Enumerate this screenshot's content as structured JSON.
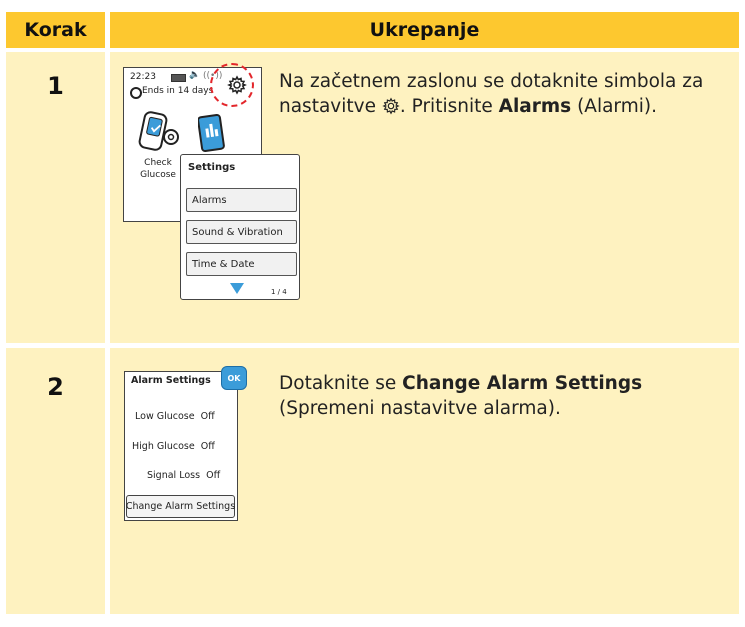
{
  "header": {
    "step_label": "Korak",
    "action_label": "Ukrepanje"
  },
  "colors": {
    "header_bg": "#fdc82f",
    "row_bg": "#fef2c0",
    "accent_blue": "#3b9cd9",
    "red_dashed": "#e3262b"
  },
  "steps": [
    {
      "number": "1",
      "text_before": "Na začetnem zaslonu se dotaknite simbola za nastavitve",
      "text_mid": ". Pritisnite ",
      "bold": "Alarms",
      "text_after": " (Alarmi).",
      "screen": {
        "time": "22:23",
        "sensor_status": "Ends in 14 days",
        "check_glucose": "Check Glucose",
        "settings_title": "Settings",
        "menu_items": [
          "Alarms",
          "Sound & Vibration",
          "Time & Date"
        ],
        "page": "1 / 4"
      }
    },
    {
      "number": "2",
      "text_before": "Dotaknite se ",
      "bold": "Change Alarm Settings",
      "text_after": " (Spremeni nastavitve alarma).",
      "screen": {
        "title": "Alarm Settings",
        "ok": "OK",
        "rows": [
          {
            "label": "Low Glucose",
            "value": "Off"
          },
          {
            "label": "High Glucose",
            "value": "Off"
          },
          {
            "label": "Signal Loss",
            "value": "Off"
          }
        ],
        "button": "Change Alarm Settings"
      }
    }
  ]
}
